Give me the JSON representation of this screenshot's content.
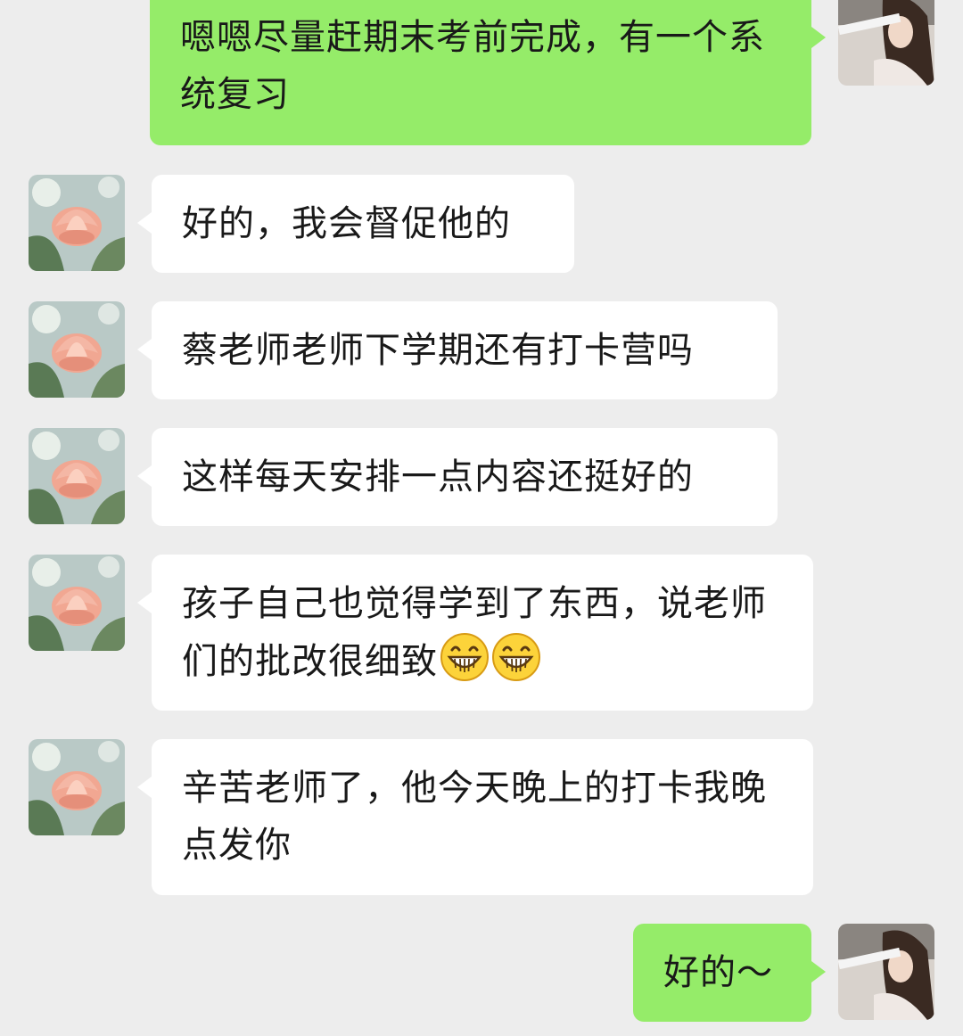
{
  "messages": [
    {
      "sender": "self",
      "text": "嗯嗯尽量赶期末考前完成，有一个系统复习"
    },
    {
      "sender": "other",
      "text": "好的，我会督促他的"
    },
    {
      "sender": "other",
      "text": "蔡老师老师下学期还有打卡营吗"
    },
    {
      "sender": "other",
      "text": "这样每天安排一点内容还挺好的"
    },
    {
      "sender": "other",
      "text": "孩子自己也觉得学到了东西，说老师们的批改很细致",
      "emojis": [
        "grinning-face-icon",
        "grinning-face-icon"
      ]
    },
    {
      "sender": "other",
      "text": "辛苦老师了，他今天晚上的打卡我晚点发你"
    },
    {
      "sender": "self",
      "text": "好的～"
    }
  ],
  "colors": {
    "background": "#ededed",
    "self_bubble": "#95ec69",
    "other_bubble": "#ffffff",
    "text": "#191919"
  }
}
